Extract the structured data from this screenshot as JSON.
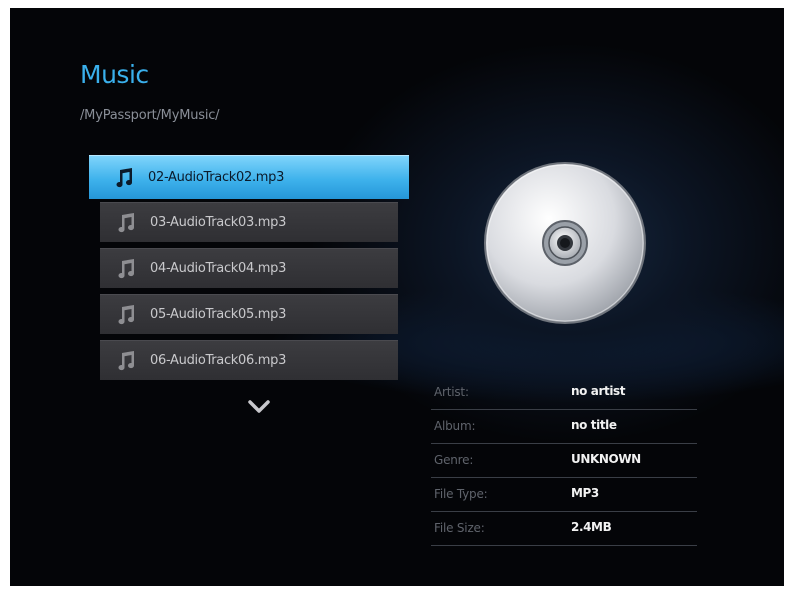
{
  "header": {
    "title": "Music",
    "path": "/MyPassport/MyMusic/"
  },
  "playlist": {
    "items": [
      {
        "label": "02-AudioTrack02.mp3",
        "icon": "music-note-icon",
        "selected": true
      },
      {
        "label": "03-AudioTrack03.mp3",
        "icon": "music-note-icon",
        "selected": false
      },
      {
        "label": "04-AudioTrack04.mp3",
        "icon": "music-note-icon",
        "selected": false
      },
      {
        "label": "05-AudioTrack05.mp3",
        "icon": "music-note-icon",
        "selected": false
      },
      {
        "label": "06-AudioTrack06.mp3",
        "icon": "music-note-icon",
        "selected": false
      }
    ],
    "scroll_icon": "chevron-down-icon"
  },
  "preview": {
    "icon": "cd-disc-icon"
  },
  "details": {
    "rows": [
      {
        "label": "Artist:",
        "value": "no artist"
      },
      {
        "label": "Album:",
        "value": "no title"
      },
      {
        "label": "Genre:",
        "value": "UNKNOWN"
      },
      {
        "label": "File Type:",
        "value": "MP3"
      },
      {
        "label": "File Size:",
        "value": "2.4MB"
      }
    ]
  },
  "colors": {
    "accent": "#3ab0ec",
    "background": "#040508",
    "item_bg": "#38383c"
  }
}
